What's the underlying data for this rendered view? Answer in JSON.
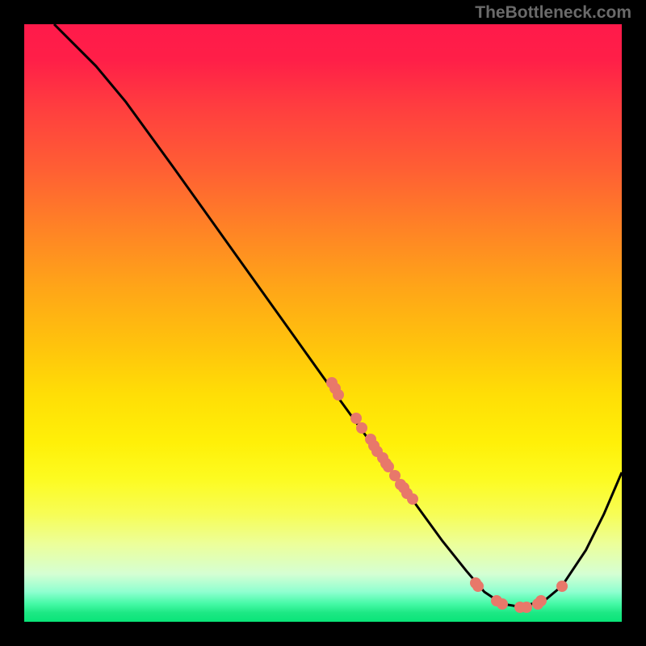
{
  "watermark": "TheBottleneck.com",
  "chart_data": {
    "type": "line",
    "title": "",
    "xlabel": "",
    "ylabel": "",
    "xlim": [
      0,
      100
    ],
    "ylim": [
      0,
      100
    ],
    "curve_points": [
      {
        "x": 5,
        "y": 100
      },
      {
        "x": 8,
        "y": 97
      },
      {
        "x": 12,
        "y": 93
      },
      {
        "x": 17,
        "y": 87
      },
      {
        "x": 25,
        "y": 76
      },
      {
        "x": 35,
        "y": 62
      },
      {
        "x": 45,
        "y": 48
      },
      {
        "x": 50,
        "y": 41
      },
      {
        "x": 54,
        "y": 35.5
      },
      {
        "x": 58,
        "y": 30
      },
      {
        "x": 62,
        "y": 24.5
      },
      {
        "x": 66,
        "y": 19
      },
      {
        "x": 70,
        "y": 13.5
      },
      {
        "x": 74,
        "y": 8.5
      },
      {
        "x": 77,
        "y": 5
      },
      {
        "x": 80,
        "y": 3
      },
      {
        "x": 83,
        "y": 2.5
      },
      {
        "x": 87,
        "y": 3.5
      },
      {
        "x": 90,
        "y": 6
      },
      {
        "x": 94,
        "y": 12
      },
      {
        "x": 97,
        "y": 18
      },
      {
        "x": 100,
        "y": 25
      }
    ],
    "data_points": [
      {
        "x": 51.5,
        "y": 40
      },
      {
        "x": 52,
        "y": 39
      },
      {
        "x": 52.5,
        "y": 38
      },
      {
        "x": 55.5,
        "y": 34
      },
      {
        "x": 56.5,
        "y": 32.5
      },
      {
        "x": 58,
        "y": 30.5
      },
      {
        "x": 58.5,
        "y": 29.5
      },
      {
        "x": 59,
        "y": 28.5
      },
      {
        "x": 60,
        "y": 27.5
      },
      {
        "x": 60.5,
        "y": 26.5
      },
      {
        "x": 61,
        "y": 26
      },
      {
        "x": 62,
        "y": 24.5
      },
      {
        "x": 63,
        "y": 23
      },
      {
        "x": 63.5,
        "y": 22.5
      },
      {
        "x": 64,
        "y": 21.5
      },
      {
        "x": 65,
        "y": 20.5
      },
      {
        "x": 75.5,
        "y": 6.5
      },
      {
        "x": 76,
        "y": 6
      },
      {
        "x": 79,
        "y": 3.5
      },
      {
        "x": 80,
        "y": 3
      },
      {
        "x": 83,
        "y": 2.5
      },
      {
        "x": 84,
        "y": 2.5
      },
      {
        "x": 86,
        "y": 3
      },
      {
        "x": 86.5,
        "y": 3.5
      },
      {
        "x": 90,
        "y": 6
      }
    ],
    "gradient_colors": {
      "top": "#ff1a4a",
      "upper_mid": "#ff8226",
      "mid": "#ffde06",
      "lower_mid": "#ecff9a",
      "bottom": "#09e478"
    },
    "point_color": "#e8786a",
    "curve_color": "#000000"
  }
}
